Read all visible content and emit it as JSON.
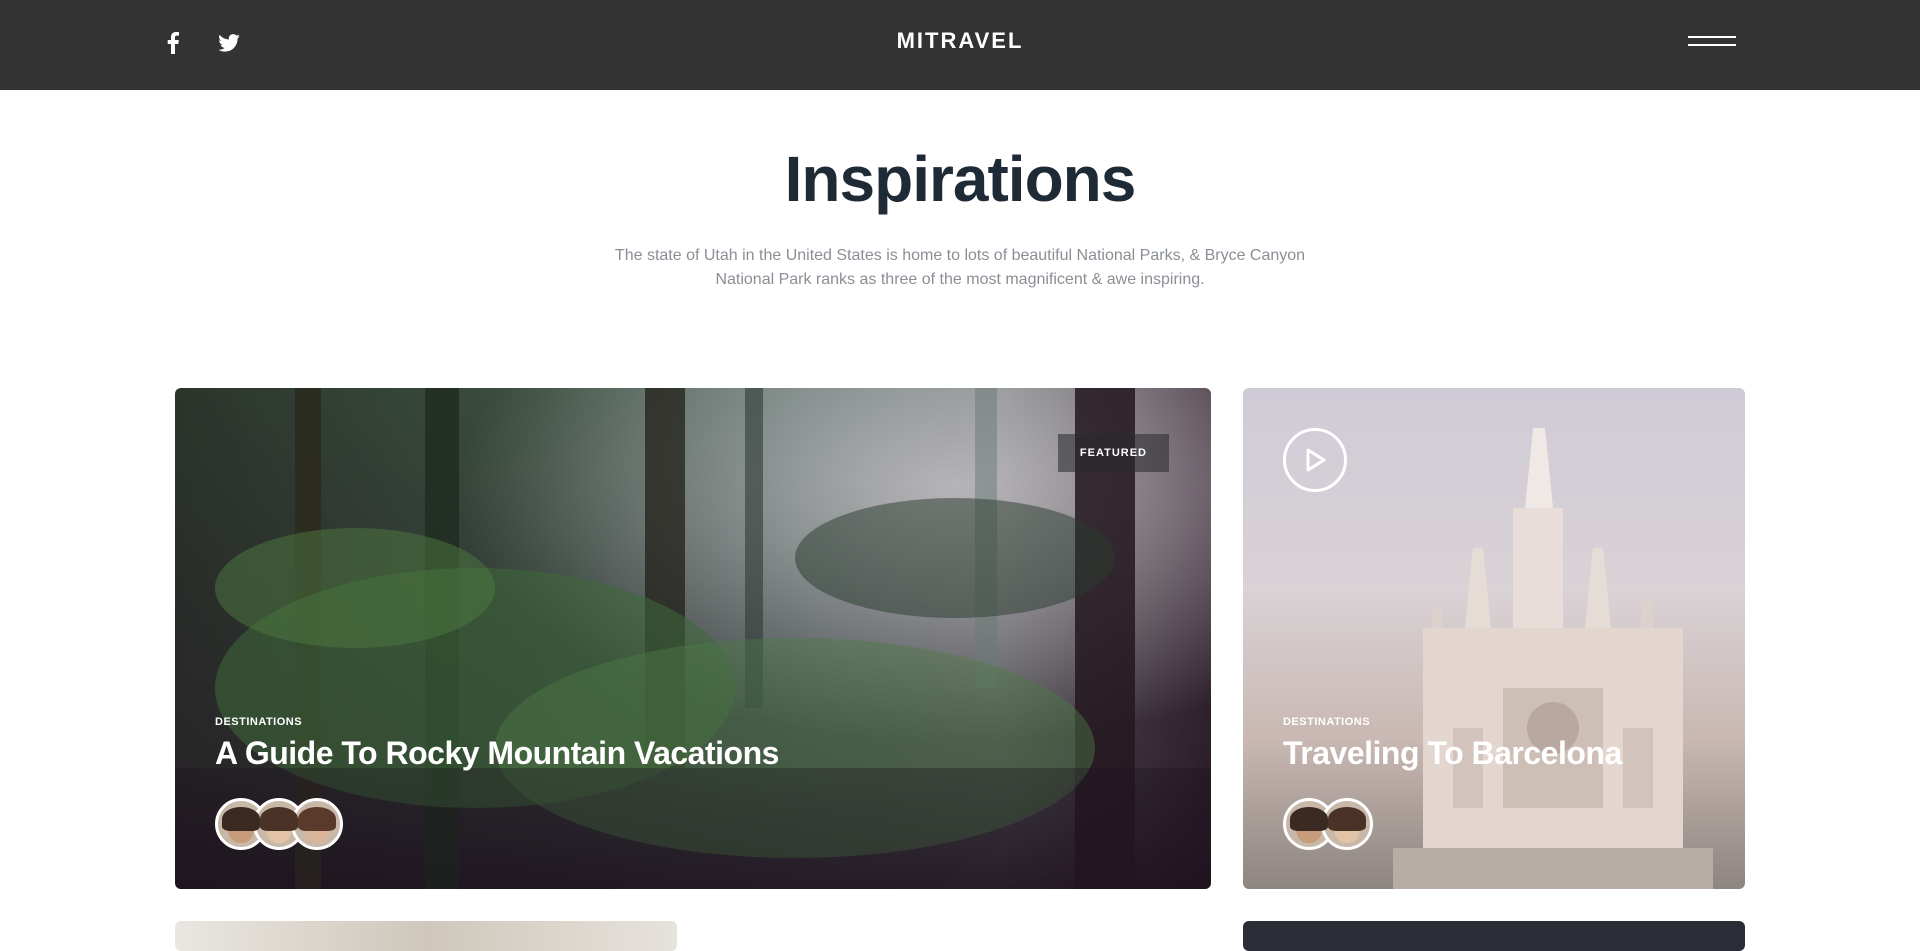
{
  "header": {
    "brand": "MITRAVEL",
    "social": [
      "facebook-icon",
      "twitter-icon"
    ],
    "menu_icon": "hamburger-menu-icon"
  },
  "intro": {
    "title": "Inspirations",
    "subtitle": "The state of Utah in the United States is home to lots of beautiful National Parks, & Bryce Canyon National Park ranks as three of the most magnificent & awe inspiring."
  },
  "cards": [
    {
      "badge": "FEATURED",
      "category": "DESTINATIONS",
      "title": "A Guide To Rocky Mountain Vacations",
      "avatars": 3
    },
    {
      "category": "DESTINATIONS",
      "title": "Traveling To Barcelona",
      "avatars": 2,
      "play_icon": "play-icon"
    }
  ],
  "colors": {
    "header_bg": "#333333",
    "title": "#1f2a37",
    "subtitle": "#8a8f96"
  }
}
